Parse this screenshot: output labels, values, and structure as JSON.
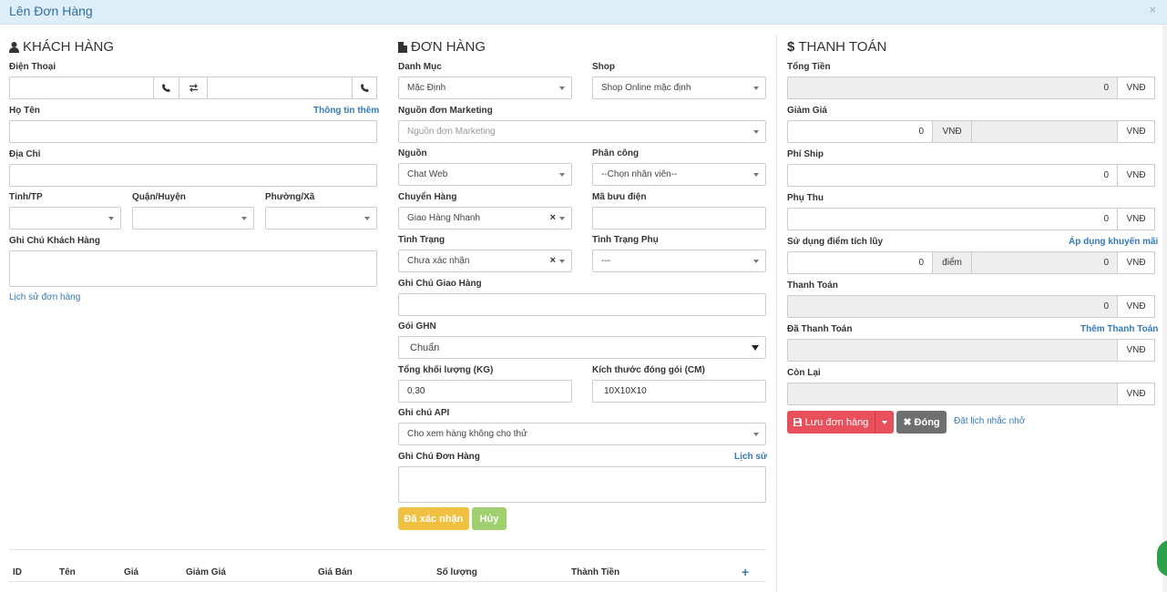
{
  "modal": {
    "title": "Lên Đơn Hàng",
    "close_icon": "×"
  },
  "customer": {
    "heading": "KHÁCH HÀNG",
    "phone_label": "Điện Thoại",
    "phone1_value": "",
    "phone2_value": "",
    "name_label": "Họ Tên",
    "more_info_link": "Thông tin thêm",
    "address_label": "Địa Chỉ",
    "province_label": "Tỉnh/TP",
    "district_label": "Quận/Huyện",
    "ward_label": "Phường/Xã",
    "note_label": "Ghi Chú Khách Hàng",
    "history_link": "Lịch sử đơn hàng"
  },
  "order": {
    "heading": "ĐƠN HÀNG",
    "category_label": "Danh Mục",
    "category_value": "Mặc Định",
    "shop_label": "Shop",
    "shop_value": "Shop Online mặc định",
    "marketing_label": "Nguồn đơn Marketing",
    "marketing_placeholder": "Nguồn đơn Marketing",
    "source_label": "Nguồn",
    "source_value": "Chat Web",
    "assign_label": "Phân công",
    "assign_value": "--Chọn nhân viên--",
    "shipping_label": "Chuyển Hàng",
    "shipping_value": "Giao Hàng Nhanh",
    "postcode_label": "Mã bưu điện",
    "status_label": "Tình Trạng",
    "status_value": "Chưa xác nhận",
    "substatus_label": "Tình Trạng Phụ",
    "substatus_value": "---",
    "delivery_note_label": "Ghi Chú Giao Hàng",
    "ghn_label": "Gói GHN",
    "ghn_value": "Chuẩn",
    "weight_label": "Tổng khối lượng (KG)",
    "weight_value": "0,30",
    "size_label": "Kích thước đóng gói (CM)",
    "size_value": "10X10X10",
    "api_note_label": "Ghi chú API",
    "api_note_value": "Cho xem hàng không cho thử",
    "order_note_label": "Ghi Chú Đơn Hàng",
    "history_link": "Lịch sử",
    "confirmed_button": "Đã xác nhận",
    "cancel_button": "Hủy"
  },
  "table": {
    "headers": [
      "ID",
      "Tên",
      "Giá",
      "Giảm Giá",
      "Giá Bán",
      "Số lượng",
      "Thành Tiền"
    ],
    "add_icon": "+"
  },
  "payment": {
    "heading": "THANH TOÁN",
    "currency": "VNĐ",
    "total_label": "Tổng Tiền",
    "total_value": "0",
    "discount_label": "Giảm Giá",
    "discount_value": "0",
    "ship_label": "Phí Ship",
    "ship_value": "0",
    "surcharge_label": "Phụ Thu",
    "surcharge_value": "0",
    "points_label": "Sử dụng điểm tích lũy",
    "promo_link": "Áp dụng khuyến mãi",
    "points_value": "0",
    "points_unit": "điểm",
    "points_money": "0",
    "payment_label": "Thanh Toán",
    "payment_value": "0",
    "paid_label": "Đã Thanh Toán",
    "add_payment_link": "Thêm Thanh Toán",
    "remaining_label": "Còn Lại",
    "save_button": "Lưu đơn hàng",
    "close_button": "Đóng",
    "reminder_link": "Đặt lịch nhắc nhở"
  },
  "colors": {
    "accent": "#337ab7",
    "save": "#e8505b",
    "close": "#6f6f6f",
    "confirm": "#f0c040",
    "cancel": "#9fcf6f"
  }
}
